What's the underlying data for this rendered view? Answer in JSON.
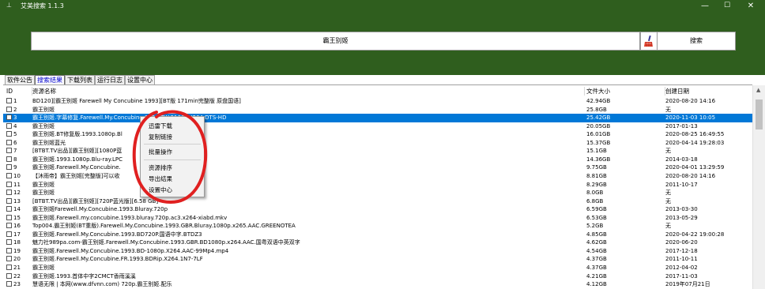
{
  "window": {
    "title": "艾美搜索 1.1.3",
    "app_icon": "⊥",
    "minimize_icon": "—",
    "maximize_icon": "☐",
    "close_icon": "✕"
  },
  "search": {
    "query": "霸王别姬",
    "button_label": "搜索"
  },
  "tabs": [
    {
      "label": "软件公告",
      "active": false
    },
    {
      "label": "搜索结果",
      "active": true
    },
    {
      "label": "下载列表",
      "active": false
    },
    {
      "label": "运行日志",
      "active": false
    },
    {
      "label": "设置中心",
      "active": false
    }
  ],
  "table": {
    "columns": [
      "ID",
      "资源名称",
      "文件大小",
      "创建日期"
    ],
    "rows": [
      {
        "id": "1",
        "name": "BD120][霸王别姬 Farewell My Concubine 1993][BT版 171min完整版 原盘国语]",
        "size": "42.94GB",
        "date": "2020-08-20 14:16"
      },
      {
        "id": "2",
        "name": "霸王别姬",
        "size": "25.8GB",
        "date": "无"
      },
      {
        "id": "3",
        "name": "霸王别姬.字幕修复.Farewell.My.Concubine.1993.TW.2160P.X264.DTS-HD",
        "size": "25.42GB",
        "date": "2020-11-03 10:05"
      },
      {
        "id": "4",
        "name": "霸王别姬",
        "size": "20.05GB",
        "date": "2017-01-13"
      },
      {
        "id": "5",
        "name": "霸王别姬.BT修复版.1993.1080p.Bl",
        "size": "16.01GB",
        "date": "2020-08-25 16:49:55"
      },
      {
        "id": "6",
        "name": "霸王别姬蓝光",
        "size": "15.37GB",
        "date": "2020-04-14 19:28:03"
      },
      {
        "id": "7",
        "name": "[BTBT.TV出品][霸王别姬][1080P蓝",
        "size": "15.1GB",
        "date": "无"
      },
      {
        "id": "8",
        "name": "霸王别姬.1993.1080p.Blu-ray.LPC",
        "size": "14.36GB",
        "date": "2014-03-18"
      },
      {
        "id": "9",
        "name": "霸王别姬.Farewell.My.Concubine.",
        "size": "9.75GB",
        "date": "2020-04-01 13:29:59"
      },
      {
        "id": "10",
        "name": "【沐雨帝】霸王别姬[完整版]可以收",
        "size": "8.81GB",
        "date": "2020-08-20 14:16"
      },
      {
        "id": "11",
        "name": "霸王别姬",
        "size": "8.29GB",
        "date": "2011-10-17"
      },
      {
        "id": "12",
        "name": "霸王别姬",
        "size": "8.0GB",
        "date": "无"
      },
      {
        "id": "13",
        "name": "[BTBT.TV出品][霸王别姬][720P蓝光版][6.58 GB]",
        "size": "6.8GB",
        "date": "无"
      },
      {
        "id": "14",
        "name": "霸王别姬Farewell.My.Concubine.1993.Bluray.720p",
        "size": "6.59GB",
        "date": "2013-03-30"
      },
      {
        "id": "15",
        "name": "霸王别姬.Farewell.my.concubine.1993.bluray.720p.ac3.x264-xiabd.mkv",
        "size": "6.53GB",
        "date": "2013-05-29"
      },
      {
        "id": "16",
        "name": "Top004.霸王别姬(BT重版).Farewell.My.Concubine.1993.GBR.Bluray.1080p.x265.AAC.GREENOTEA",
        "size": "5.2GB",
        "date": "无"
      },
      {
        "id": "17",
        "name": "霸王别姬.Farewell.My.Concubine.1993.BD720P.国语中字.BTDZ3",
        "size": "4.85GB",
        "date": "2020-04-22 19:00:28"
      },
      {
        "id": "18",
        "name": "魅力社989pa.com-霸王别姬.Farewell.My.Concubine.1993.GBR.BD1080p.x264.AAC.国粤双语中英双字",
        "size": "4.62GB",
        "date": "2020-06-20"
      },
      {
        "id": "19",
        "name": "霸王别姬.Farewell.My.Concubine.1993.BD-1080p.X264.AAC-99Mp4.mp4",
        "size": "4.54GB",
        "date": "2017-12-18"
      },
      {
        "id": "20",
        "name": "霸王别姬.Farewell.My.Concubine.FR.1993.BDRip.X264.1N7-7LF",
        "size": "4.37GB",
        "date": "2011-10-11"
      },
      {
        "id": "21",
        "name": "霸王别姬",
        "size": "4.37GB",
        "date": "2012-04-02"
      },
      {
        "id": "22",
        "name": "霸王别姬.1993.首体中字2CMCT香雨溪溪",
        "size": "4.21GB",
        "date": "2017-11-03"
      },
      {
        "id": "23",
        "name": "慧语无限 | 本网(www.dfvnn.com) 720p.霸王别姬.配乐",
        "size": "4.12GB",
        "date": "2019年07月21日"
      }
    ],
    "selected_row_index": 2
  },
  "context_menu": {
    "items": [
      "迅雷下载",
      "复制链接",
      "批量操作",
      "资源排序",
      "导出结果",
      "设置中心"
    ]
  },
  "colors": {
    "titlebar_bg": "#2f5e1e",
    "selected_row": "#0078d7",
    "annotation_red": "#e02020"
  },
  "icons": {
    "broom": "broom-icon",
    "scroll_up": "▲"
  }
}
